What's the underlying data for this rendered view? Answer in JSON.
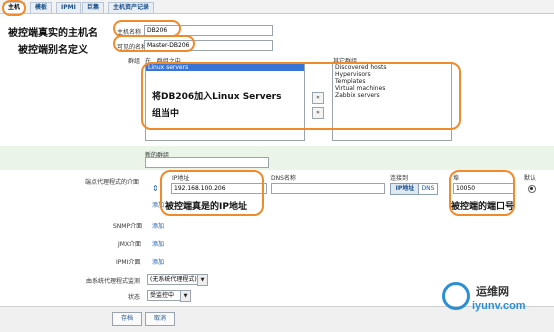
{
  "tabs": [
    "主机",
    "模板",
    "IPMI",
    "巨集",
    "主机资产记录"
  ],
  "form": {
    "host_name_label": "主机名称",
    "host_name_value": "DB206",
    "visible_name_label": "可见的名称",
    "visible_name_value": "Master-DB206",
    "groups_label": "群组",
    "in_groups_label": "在...群组之中",
    "other_groups_label": "其它群组",
    "in_groups": [
      "Linux servers"
    ],
    "other_groups": [
      "Discovered hosts",
      "Hypervisors",
      "Templates",
      "Virtual machines",
      "Zabbix servers"
    ],
    "move_left": "«",
    "move_right": "»",
    "new_group_label": "新的群组",
    "agent_interfaces_label": "端点代理程式的介面",
    "ip_col": "IP地址",
    "dns_col": "DNS名称",
    "connect_to_col": "连接到",
    "port_col": "埠",
    "default_col": "默认",
    "ip_value": "192.168.100.206",
    "dns_value": "",
    "connect_ip": "IP地址",
    "connect_dns": "DNS",
    "port_value": "10050",
    "add": "添加",
    "snmp_label": "SNMP介面",
    "jmx_label": "JMX介面",
    "ipmi_label": "IPMI介面",
    "proxy_label": "由系统代理程式监测",
    "proxy_value": "(无系统代理程式)",
    "status_label": "状态",
    "status_value": "受监控中",
    "save_button": "存档",
    "cancel_button": "取消"
  },
  "annotations": {
    "real_host_name": "被控端真实的主机名",
    "alias": "被控端别名定义",
    "add_to_group": "将DB206加入Linux Servers",
    "add_to_group_2": "组当中",
    "real_ip": "被控端真是的IP地址",
    "port": "被控端的端口号"
  },
  "watermark": {
    "text_cn": "运维网",
    "text_en": "iyunv.com"
  },
  "colors": {
    "annotation_ring": "#f08a2b",
    "link": "#1a5bab",
    "selected": "#3875d7"
  }
}
